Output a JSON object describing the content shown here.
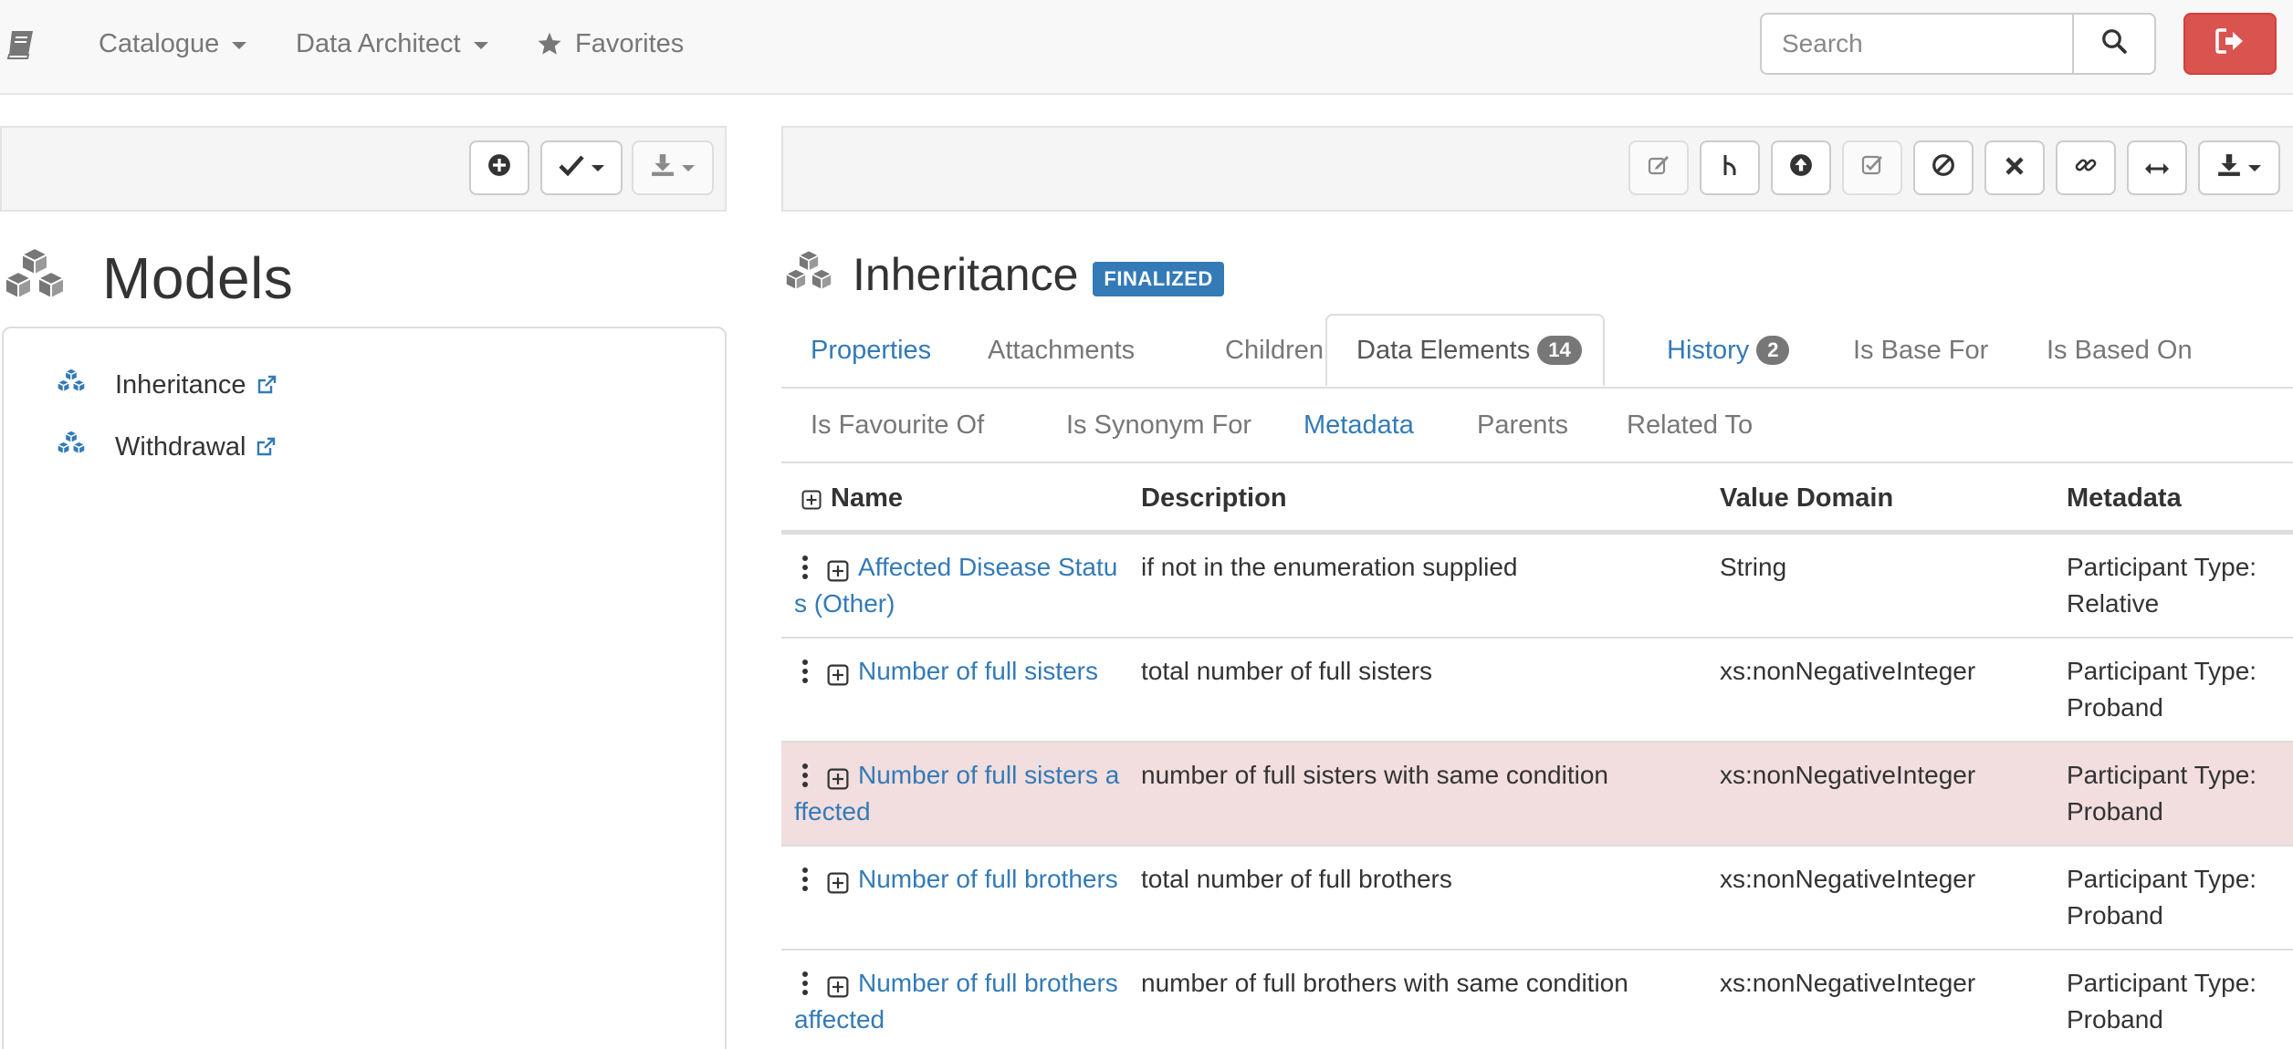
{
  "navbar": {
    "brand_icon": "book-icon",
    "catalogue_label": "Catalogue",
    "data_architect_label": "Data Architect",
    "favorites_label": "Favorites",
    "search_placeholder": "Search",
    "search_icon": "search-icon",
    "logout_icon": "sign-out-icon",
    "logout_color": "#d9534f"
  },
  "left_toolbar": {
    "buttons": [
      "plus-circle-icon",
      "check-icon-dropdown",
      "download-icon-dropdown"
    ]
  },
  "right_toolbar": {
    "buttons": [
      "edit-icon",
      "fork-icon",
      "upload-circle-icon",
      "validate-icon",
      "ban-icon",
      "delete-icon",
      "link-icon",
      "resize-horizontal-icon",
      "download-icon-dropdown"
    ]
  },
  "models": {
    "title": "Models",
    "items": [
      {
        "label": "Inheritance"
      },
      {
        "label": "Withdrawal"
      }
    ]
  },
  "element": {
    "title": "Inheritance",
    "status": "FINALIZED",
    "status_color": "#337ab7"
  },
  "tabs": {
    "row1": [
      {
        "label": "Properties"
      },
      {
        "label": "Attachments"
      },
      {
        "label": "Children"
      },
      {
        "label": "Data Elements",
        "count": "14"
      },
      {
        "label": "History",
        "count": "2"
      },
      {
        "label": "Is Base For"
      },
      {
        "label": "Is Based On"
      }
    ],
    "row2": [
      {
        "label": "Is Favourite Of"
      },
      {
        "label": "Is Synonym For"
      },
      {
        "label": "Metadata"
      },
      {
        "label": "Parents"
      },
      {
        "label": "Related To"
      }
    ]
  },
  "table": {
    "columns": {
      "name": "Name",
      "description": "Description",
      "value_domain": "Value Domain",
      "metadata": "Metadata"
    },
    "rows": [
      {
        "name": "Affected Disease Status (Other)",
        "description": "if not in the enumeration supplied",
        "value_domain": "String",
        "metadata": "Participant Type: Relative"
      },
      {
        "name": "Number of full sisters",
        "description": "total number of full sisters",
        "value_domain": "xs:nonNegativeInteger",
        "metadata": "Participant Type: Proband"
      },
      {
        "name": "Number of full sisters affected",
        "description": "number of full sisters with same condition",
        "value_domain": "xs:nonNegativeInteger",
        "metadata": "Participant Type: Proband"
      },
      {
        "name": "Number of full brothers",
        "description": "total number of full brothers",
        "value_domain": "xs:nonNegativeInteger",
        "metadata": "Participant Type: Proband"
      },
      {
        "name": "Number of full brothers affected",
        "description": "number of full brothers with same condition",
        "value_domain": "xs:nonNegativeInteger",
        "metadata": "Participant Type: Proband"
      }
    ],
    "highlight_color": "#f2dede"
  }
}
